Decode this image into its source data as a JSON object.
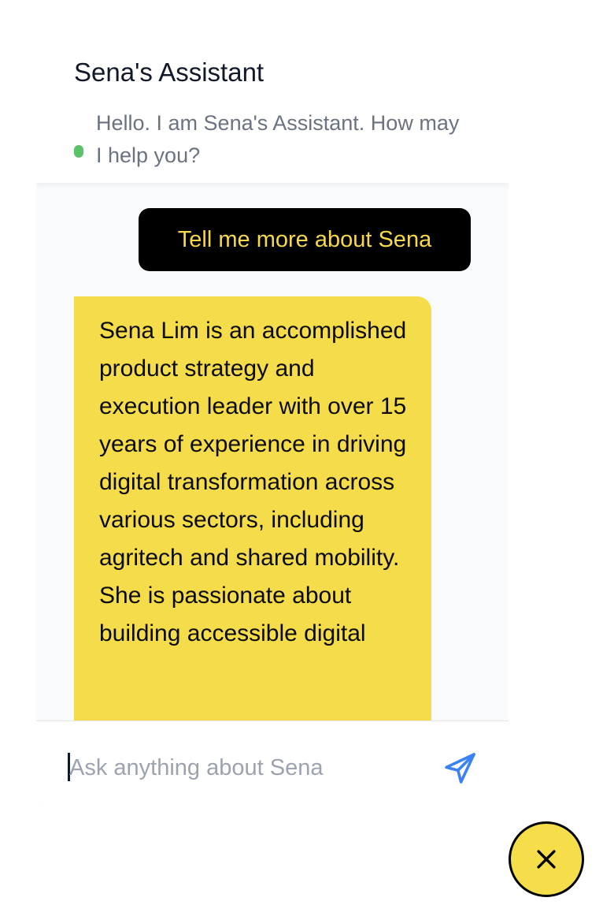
{
  "header": {
    "title": "Sena's Assistant",
    "greeting": "Hello. I am Sena's Assistant. How may I help you?",
    "status_color": "#5cc26a"
  },
  "messages": [
    {
      "role": "user",
      "text": "Tell me more about Sena"
    },
    {
      "role": "assistant",
      "text": "Sena Lim is an accomplished product strategy and execution leader with over 15 years of experience in driving digital transformation across various sectors, including agritech and shared mobility. She is passionate about building accessible digital"
    }
  ],
  "composer": {
    "placeholder": "Ask anything about Sena",
    "value": "",
    "send_icon": "send-icon"
  },
  "launcher": {
    "close_icon": "close-icon"
  },
  "colors": {
    "accent_yellow": "#f6de4a",
    "user_bubble": "#000000",
    "send_blue": "#3b82f6"
  }
}
